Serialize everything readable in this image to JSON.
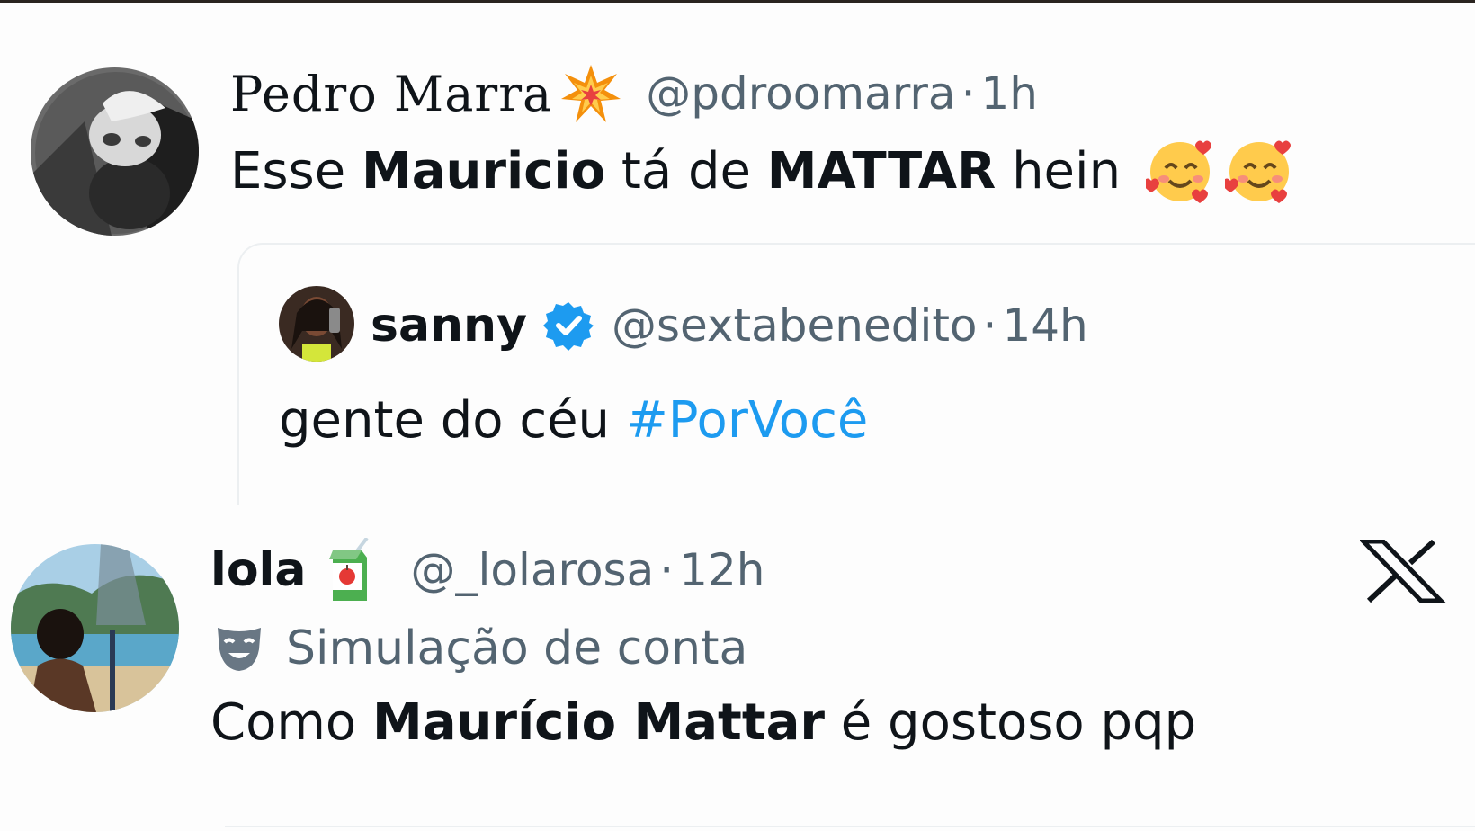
{
  "tweet1": {
    "name": "Pedro Marra",
    "name_emoji": "collision-emoji",
    "handle": "@pdroomarra",
    "separator": "·",
    "time": "1h",
    "text_parts": [
      "Esse ",
      "Mauricio",
      " tá de ",
      "MATTAR",
      " hein "
    ],
    "emojis": [
      "smiling-face-with-hearts-emoji",
      "smiling-face-with-hearts-emoji"
    ]
  },
  "quoted": {
    "name": "sanny",
    "verified_icon": "verified-badge-icon",
    "handle": "@sextabenedito",
    "separator": "·",
    "time": "14h",
    "text": "gente do céu ",
    "hashtag": "#PorVocê",
    "colors": {
      "hashtag": "#1d9bf0",
      "verified": "#1d9bf0"
    }
  },
  "tweet2": {
    "name": "lola",
    "name_emoji": "juice-box-emoji",
    "handle": "@_lolarosa",
    "separator": "·",
    "time": "12h",
    "label_icon": "parody-mask-icon",
    "label": "Simulação de conta",
    "text_parts": [
      "Como ",
      "Maurício Mattar",
      " é gostoso pqp"
    ]
  },
  "brand_icon": "x-logo-icon"
}
